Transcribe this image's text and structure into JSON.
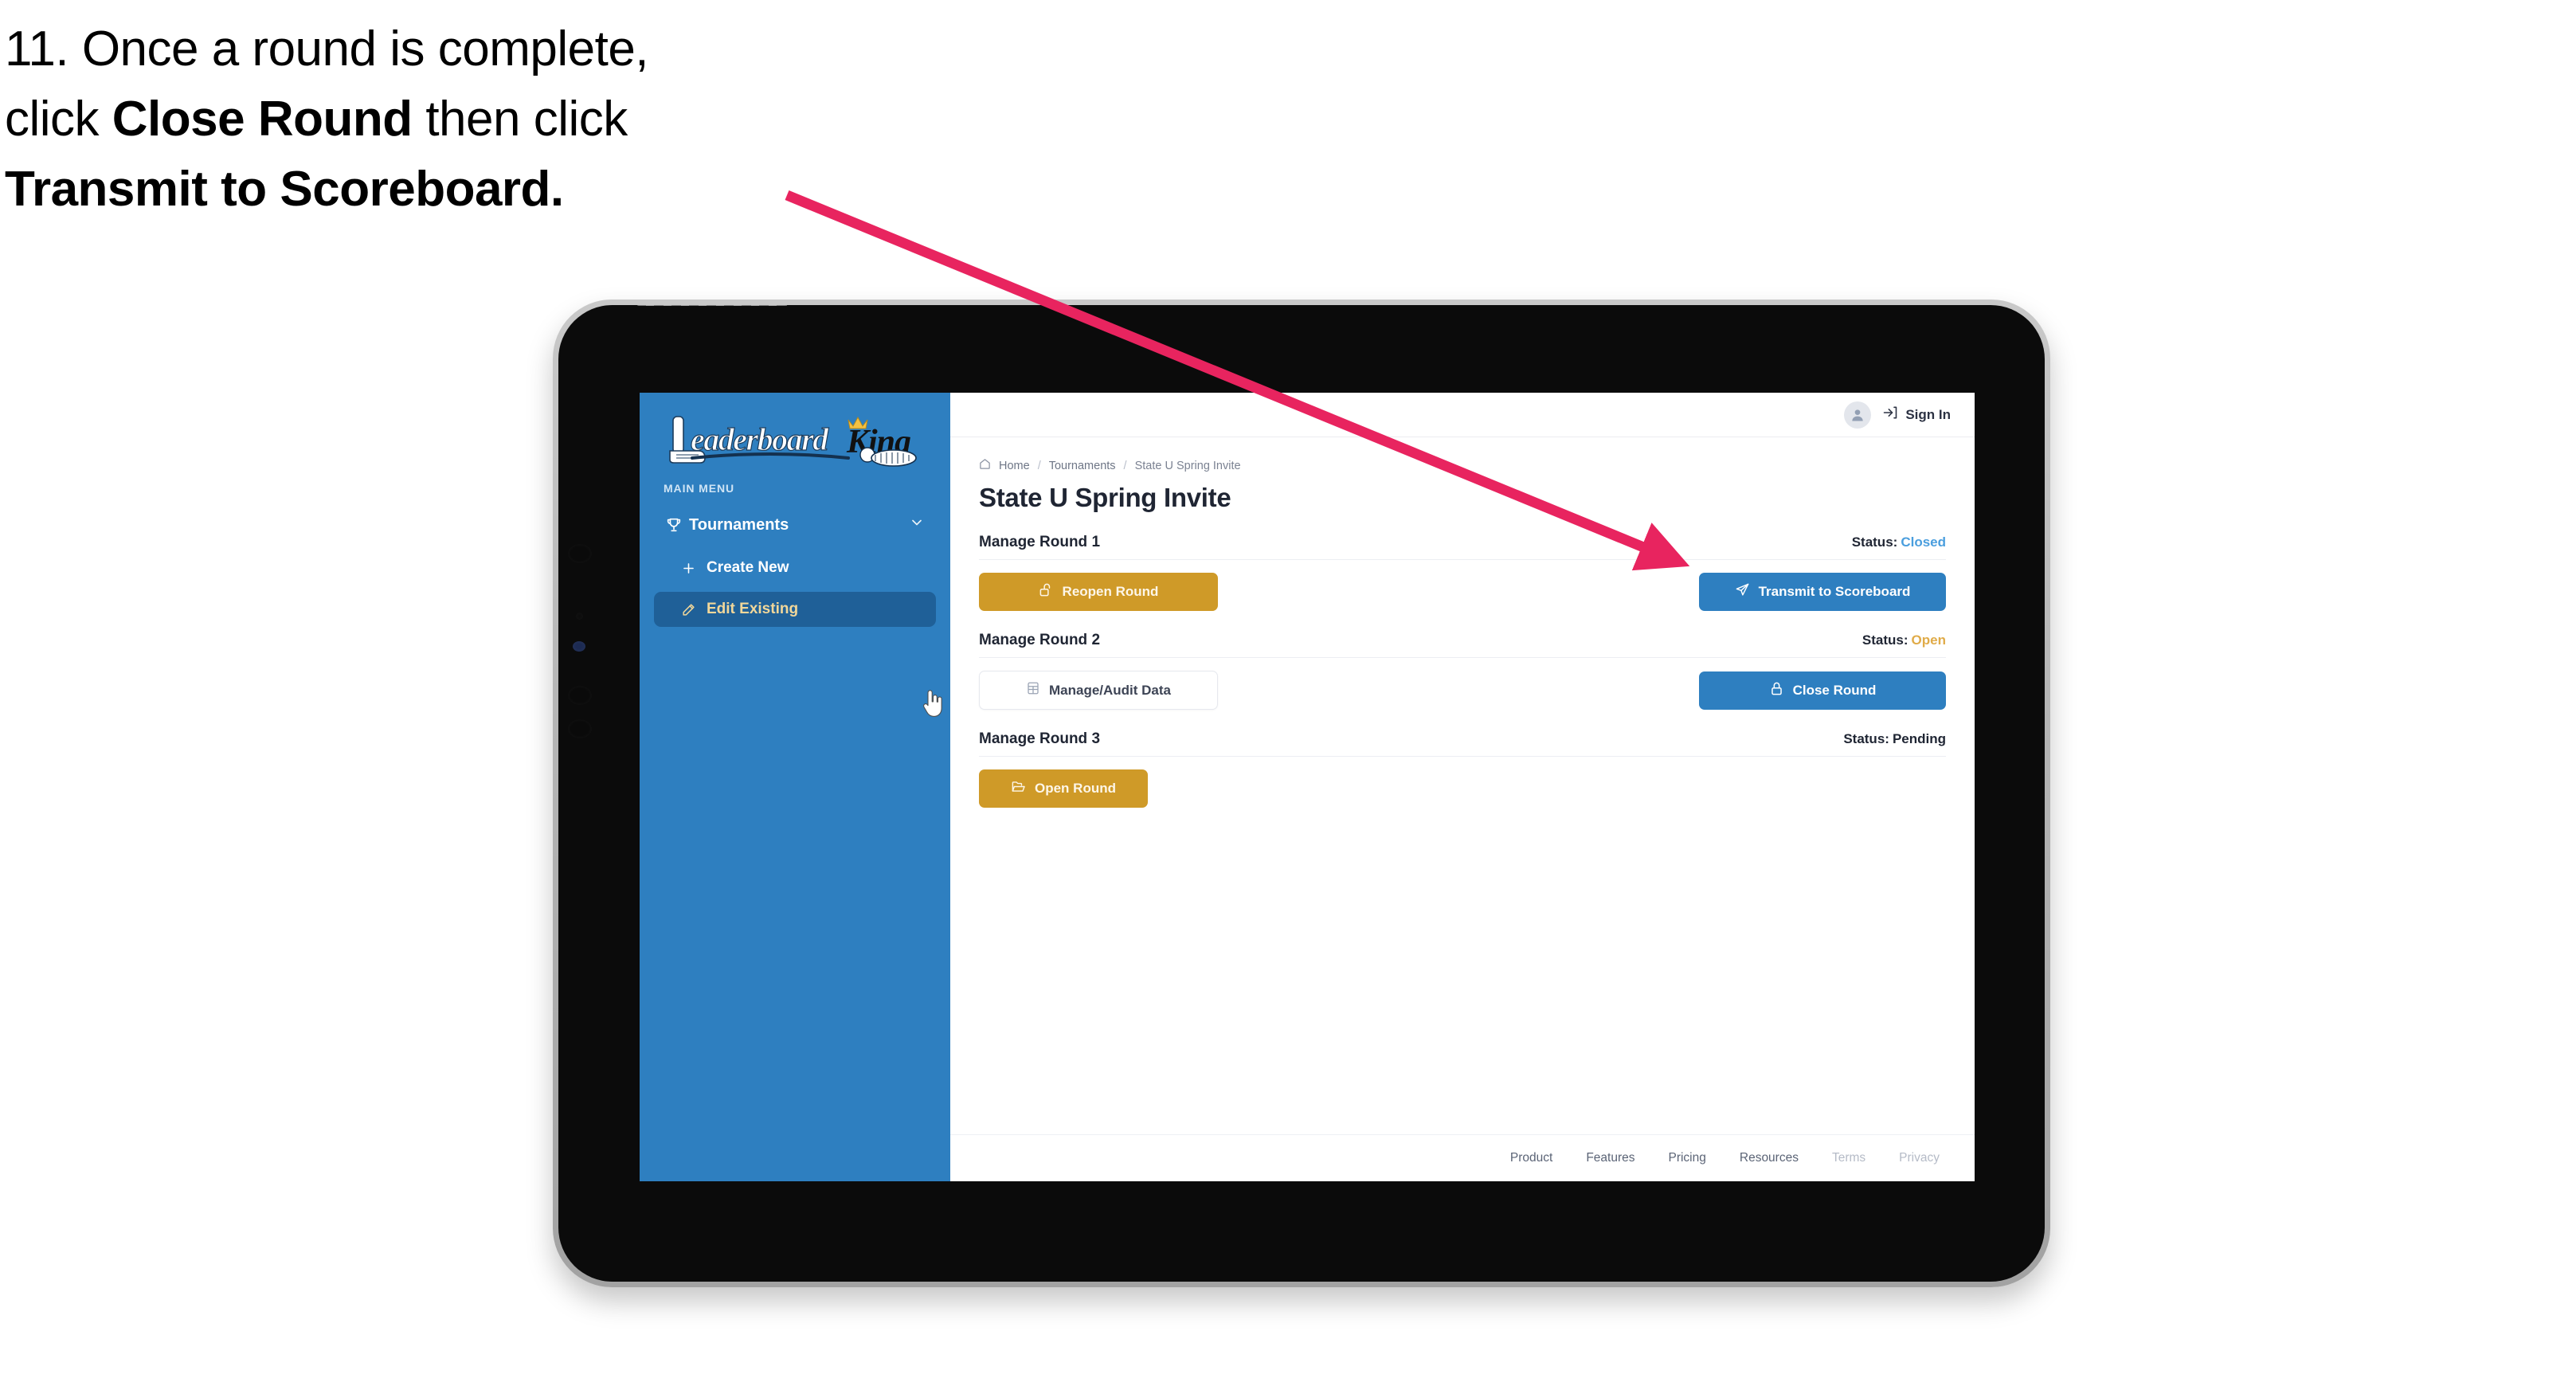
{
  "caption": {
    "line1_pre": "11. Once a round is complete,",
    "line2_pre": "click ",
    "line2_bold": "Close Round",
    "line2_post": " then click",
    "line3_bold": "Transmit to Scoreboard."
  },
  "annotation": {
    "arrow_color": "#e8245f",
    "arrow_name": "pointer-arrow-to-transmit-button"
  },
  "app": {
    "sidebar": {
      "logo": {
        "word_primary": "eaderboard",
        "word_secondary": "King",
        "icon": "golf-putter-icon",
        "crown": "crown-icon"
      },
      "section_label": "MAIN MENU",
      "items": [
        {
          "label": "Tournaments",
          "icon": "trophy-icon",
          "chevron": "chevron-down-icon",
          "active": false
        },
        {
          "label": "Create New",
          "icon": "plus-icon",
          "active": false
        },
        {
          "label": "Edit Existing",
          "icon": "pencil-square-icon",
          "active": true
        }
      ],
      "cursor": "pointing-hand-cursor"
    },
    "topbar": {
      "avatar_icon": "user-avatar-icon",
      "signin_icon": "sign-in-arrow-icon",
      "signin_label": "Sign In"
    },
    "breadcrumb": {
      "home_icon": "home-icon",
      "items": [
        "Home",
        "Tournaments",
        "State U Spring Invite"
      ],
      "separator": "/"
    },
    "page_title": "State U Spring Invite",
    "status_label": "Status:",
    "rounds": [
      {
        "name": "Manage Round 1",
        "status_value": "Closed",
        "status_class": "closed",
        "left_button": {
          "label": "Reopen Round",
          "icon": "unlock-icon",
          "style": "gold"
        },
        "right_button": {
          "label": "Transmit to Scoreboard",
          "icon": "paper-plane-icon",
          "style": "blue"
        }
      },
      {
        "name": "Manage Round 2",
        "status_value": "Open",
        "status_class": "open",
        "left_button": {
          "label": "Manage/Audit Data",
          "icon": "table-grid-icon",
          "style": "outline"
        },
        "right_button": {
          "label": "Close Round",
          "icon": "lock-icon",
          "style": "blue"
        }
      },
      {
        "name": "Manage Round 3",
        "status_value": "Pending",
        "status_class": "pending",
        "left_button": {
          "label": "Open Round",
          "icon": "open-folder-icon",
          "style": "gold"
        },
        "right_button": null
      }
    ],
    "footer": {
      "links": [
        {
          "label": "Product",
          "muted": false
        },
        {
          "label": "Features",
          "muted": false
        },
        {
          "label": "Pricing",
          "muted": false
        },
        {
          "label": "Resources",
          "muted": false
        },
        {
          "label": "Terms",
          "muted": true
        },
        {
          "label": "Privacy",
          "muted": true
        }
      ]
    }
  },
  "colors": {
    "sidebar_blue": "#2e7fc0",
    "sidebar_active": "#1f6098",
    "gold": "#cf9a28",
    "blue_button": "#2e7fc0",
    "status_closed": "#4a9ede",
    "status_open": "#e0ab48",
    "arrow_pink": "#e8245f"
  }
}
